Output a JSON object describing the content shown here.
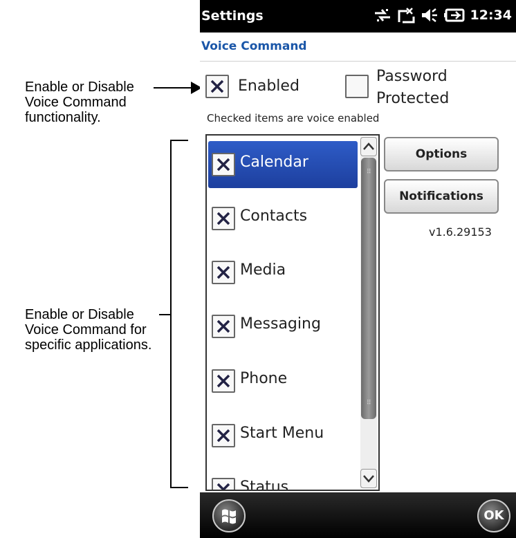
{
  "annotations": {
    "top": "Enable or Disable Voice Command functionality.",
    "apps": "Enable or Disable Voice Command for specific applications."
  },
  "statusbar": {
    "title": "Settings",
    "time": "12:34",
    "icons": [
      "connectivity-icon",
      "signal-off-icon",
      "volume-icon",
      "battery-icon"
    ]
  },
  "page": {
    "heading": "Voice Command"
  },
  "options": {
    "enabled_label": "Enabled",
    "enabled_checked": true,
    "password_label": "Password Protected",
    "password_checked": false
  },
  "hint": "Checked items are voice enabled",
  "apps_list": [
    {
      "label": "Calendar",
      "checked": true,
      "selected": true
    },
    {
      "label": "Contacts",
      "checked": true
    },
    {
      "label": "Media",
      "checked": true
    },
    {
      "label": "Messaging",
      "checked": true
    },
    {
      "label": "Phone",
      "checked": true
    },
    {
      "label": "Start Menu",
      "checked": true
    },
    {
      "label": "Status",
      "checked": true
    }
  ],
  "buttons": {
    "options": "Options",
    "notifications": "Notifications"
  },
  "version": "v1.6.29153",
  "bottombar": {
    "ok": "OK"
  },
  "colors": {
    "accent": "#1a56a8",
    "selection": "#2e5cc7"
  }
}
